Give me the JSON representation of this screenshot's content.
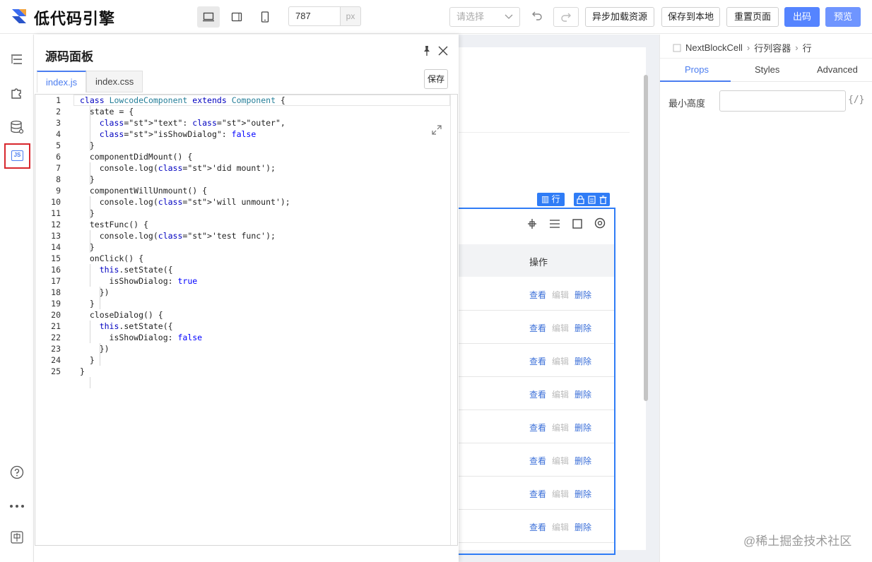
{
  "app": {
    "title": "低代码引擎"
  },
  "toolbar": {
    "width_value": "787",
    "width_unit": "px",
    "select_placeholder": "请选择",
    "async_load_label": "异步加载资源",
    "save_local_label": "保存到本地",
    "reset_label": "重置页面",
    "export_label": "出码",
    "preview_label": "预览"
  },
  "code_panel": {
    "title": "源码面板",
    "tabs": [
      "index.js",
      "index.css"
    ],
    "save_label": "保存",
    "lines": [
      {
        "n": "1",
        "t": "class LowcodeComponent extends Component {"
      },
      {
        "n": "2",
        "t": "  state = {"
      },
      {
        "n": "3",
        "t": "    \"text\": \"outer\","
      },
      {
        "n": "4",
        "t": "    \"isShowDialog\": false"
      },
      {
        "n": "5",
        "t": "  }"
      },
      {
        "n": "6",
        "t": "  componentDidMount() {"
      },
      {
        "n": "7",
        "t": "    console.log('did mount');"
      },
      {
        "n": "8",
        "t": "  }"
      },
      {
        "n": "9",
        "t": "  componentWillUnmount() {"
      },
      {
        "n": "10",
        "t": "    console.log('will unmount');"
      },
      {
        "n": "11",
        "t": "  }"
      },
      {
        "n": "12",
        "t": "  testFunc() {"
      },
      {
        "n": "13",
        "t": "    console.log('test func');"
      },
      {
        "n": "14",
        "t": "  }"
      },
      {
        "n": "15",
        "t": "  onClick() {"
      },
      {
        "n": "16",
        "t": "    this.setState({"
      },
      {
        "n": "17",
        "t": "      isShowDialog: true"
      },
      {
        "n": "18",
        "t": "    })"
      },
      {
        "n": "19",
        "t": "  }"
      },
      {
        "n": "20",
        "t": "  closeDialog() {"
      },
      {
        "n": "21",
        "t": "    this.setState({"
      },
      {
        "n": "22",
        "t": "      isShowDialog: false"
      },
      {
        "n": "23",
        "t": "    })"
      },
      {
        "n": "24",
        "t": "  }"
      },
      {
        "n": "25",
        "t": "}"
      }
    ]
  },
  "canvas": {
    "row_tag": "行",
    "op_header": "操作",
    "view_label": "查看",
    "edit_label": "编辑",
    "delete_label": "删除",
    "row_count": 8
  },
  "right_panel": {
    "breadcrumb": [
      "NextBlockCell",
      "行列容器",
      "行"
    ],
    "tabs": [
      "Props",
      "Styles",
      "Advanced"
    ],
    "min_height_label": "最小高度",
    "var_button": "{/}"
  },
  "watermark": "@稀土掘金技术社区",
  "colors": {
    "primary": "#5584ff",
    "selection": "#2f7cf6",
    "highlight_border": "#d8272d"
  }
}
